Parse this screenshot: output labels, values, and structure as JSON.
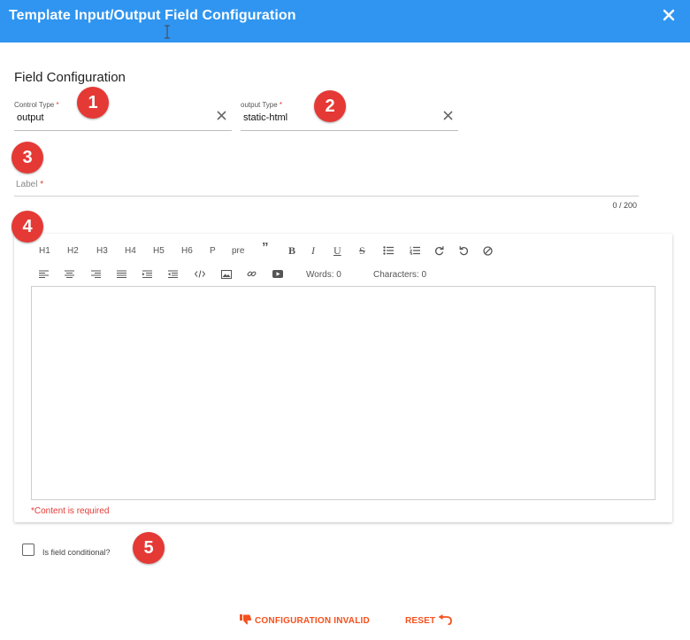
{
  "window": {
    "title": "Template Input/Output Field Configuration",
    "close_icon": "close-icon",
    "color": "#2f95f0"
  },
  "section": {
    "title": "Field Configuration"
  },
  "control_type": {
    "label": "Control Type",
    "required_mark": "*",
    "value": "output"
  },
  "output_type": {
    "label": "output Type",
    "required_mark": "*",
    "value": "static-html"
  },
  "label_field": {
    "label": "Label",
    "required_mark": "*",
    "value": "",
    "counter": "0 / 200"
  },
  "editor": {
    "toolbar_row1": [
      "H1",
      "H2",
      "H3",
      "H4",
      "H5",
      "H6",
      "P",
      "pre",
      "”",
      "B",
      "I",
      "U",
      "S"
    ],
    "toolbar_row1_icons": [
      "bullet-list-icon",
      "numbered-list-icon",
      "redo-icon",
      "undo-icon",
      "clear-format-icon"
    ],
    "toolbar_row2_icons": [
      "align-left-icon",
      "align-center-icon",
      "align-right-icon",
      "align-justify-icon",
      "indent-icon",
      "outdent-icon",
      "code-icon",
      "image-icon",
      "link-icon",
      "video-icon"
    ],
    "words": "Words: 0",
    "characters": "Characters: 0",
    "error": "*Content is required"
  },
  "conditional": {
    "label": "Is field conditional?",
    "checked": false
  },
  "footer": {
    "invalid_label": "CONFIGURATION INVALID",
    "reset_label": "RESET",
    "accent": "#f4511e"
  },
  "badges": [
    "1",
    "2",
    "3",
    "4",
    "5"
  ],
  "badge_color": "#e53935"
}
